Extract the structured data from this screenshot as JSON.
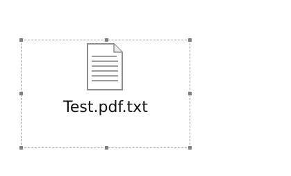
{
  "file": {
    "name": "Test.pdf.txt",
    "icon": "text-document-icon"
  },
  "selection": {
    "style": "dashed",
    "handle_color": "#7f7f7f",
    "border_color": "#9a9a9a"
  }
}
